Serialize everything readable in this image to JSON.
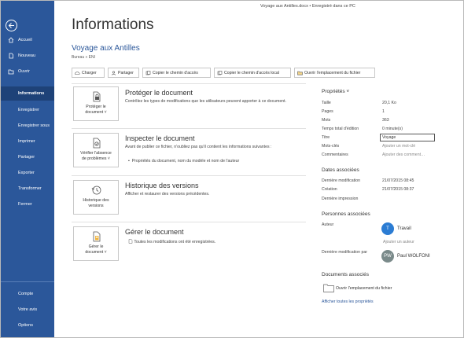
{
  "titlebar": "Voyage aux Antilles.docx  •  Enregistré dans ce PC",
  "sidebar": {
    "top": [
      {
        "label": "Accueil",
        "icon": "home-icon"
      },
      {
        "label": "Nouveau",
        "icon": "new-document-icon"
      },
      {
        "label": "Ouvrir",
        "icon": "folder-open-icon"
      }
    ],
    "items": [
      "Informations",
      "Enregistrer",
      "Enregistrer sous",
      "Imprimer",
      "Partager",
      "Exporter",
      "Transformer",
      "Fermer"
    ],
    "bottom": [
      "Compte",
      "Votre avis",
      "Options"
    ],
    "active_color": "#1e4278",
    "bg_color": "#2b579a"
  },
  "page": {
    "title": "Informations",
    "doc_name": "Voyage aux Antilles",
    "doc_path": "Bureau » ENI"
  },
  "toolbar": {
    "charger": "Charger",
    "partager": "Partager",
    "copy_path": "Copier le chemin d'accès",
    "copy_local_path": "Copier le chemin d'accès local",
    "open_location": "Ouvrir l'emplacement du fichier"
  },
  "sections": {
    "protect": {
      "card": "Protéger le document ˅",
      "card_l1": "Protéger le",
      "card_l2": "document ˅",
      "title": "Protéger le document",
      "desc": "Contrôlez les types de modifications que les utilisateurs peuvent apporter à ce document."
    },
    "inspect": {
      "card_l1": "Vérifier l'absence",
      "card_l2": "de problèmes ˅",
      "title": "Inspecter le document",
      "desc": "Avant de publier ce fichier, n'oubliez pas qu'il contient les informations suivantes :",
      "bullet": "Propriétés du document, nom du modèle et nom de l'auteur"
    },
    "versions": {
      "card_l1": "Historique des",
      "card_l2": "versions",
      "title": "Historique des versions",
      "desc": "Afficher et restaurer des versions précédentes."
    },
    "manage": {
      "card_l1": "Gérer le",
      "card_l2": "document ˅",
      "title": "Gérer le document",
      "desc": "Toutes les modifications ont été enregistrées."
    }
  },
  "properties": {
    "title": "Propriétés ˅",
    "rows": [
      {
        "label": "Taille",
        "value": "20,1 Ko"
      },
      {
        "label": "Pages",
        "value": "1"
      },
      {
        "label": "Mots",
        "value": "363"
      },
      {
        "label": "Temps total d'édition",
        "value": "0 minute(s)"
      },
      {
        "label": "Titre",
        "value": "Voyage"
      },
      {
        "label": "Mots-clés",
        "value": "Ajouter un mot-clé"
      },
      {
        "label": "Commentaires",
        "value": "Ajouter des comment…"
      }
    ],
    "dates_title": "Dates associées",
    "dates": [
      {
        "label": "Dernière modification",
        "value": "21/07/2015 08:45"
      },
      {
        "label": "Création",
        "value": "21/07/2015 08:37"
      },
      {
        "label": "Dernière impression",
        "value": ""
      }
    ],
    "people_title": "Personnes associées",
    "author_label": "Auteur",
    "author_initial": "T",
    "author_name": "Travail",
    "add_author": "Ajouter un auteur",
    "modified_by_label": "Dernière modification par",
    "modified_by_initials": "PW",
    "modified_by_name": "Paul WOLFONI",
    "docs_title": "Documents associés",
    "open_location": "Ouvrir l'emplacement du fichier",
    "show_all": "Afficher toutes les propriétés",
    "accent_color": "#2b579a"
  }
}
